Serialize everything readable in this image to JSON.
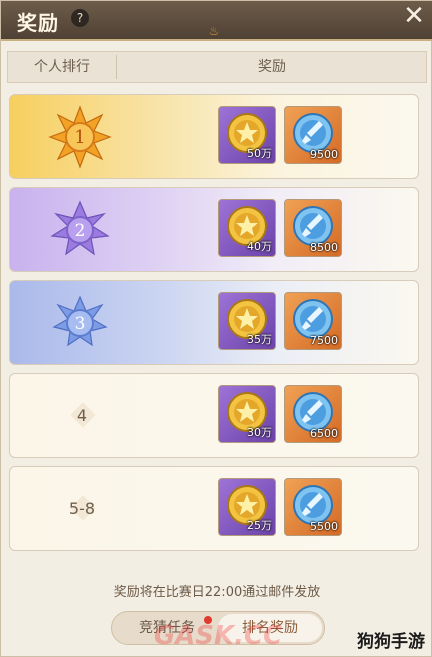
{
  "dialog": {
    "title": "奖励",
    "help_label": "?",
    "close_label": "✕",
    "ornament": "♨"
  },
  "header": {
    "rank_col": "个人排行",
    "reward_col": "奖励"
  },
  "rows": [
    {
      "rank": "1",
      "style": "gold",
      "rewards": [
        {
          "icon": "gold-coin-icon",
          "frame": "purple",
          "qty": "50万"
        },
        {
          "icon": "blue-sword-token-icon",
          "frame": "orange",
          "qty": "9500"
        }
      ]
    },
    {
      "rank": "2",
      "style": "purple",
      "rewards": [
        {
          "icon": "gold-coin-icon",
          "frame": "purple",
          "qty": "40万"
        },
        {
          "icon": "blue-sword-token-icon",
          "frame": "orange",
          "qty": "8500"
        }
      ]
    },
    {
      "rank": "3",
      "style": "blue",
      "rewards": [
        {
          "icon": "gold-coin-icon",
          "frame": "purple",
          "qty": "35万"
        },
        {
          "icon": "blue-sword-token-icon",
          "frame": "orange",
          "qty": "7500"
        }
      ]
    },
    {
      "rank": "4",
      "style": "plain",
      "rewards": [
        {
          "icon": "gold-coin-icon",
          "frame": "purple",
          "qty": "30万"
        },
        {
          "icon": "blue-sword-token-icon",
          "frame": "orange",
          "qty": "6500"
        }
      ]
    },
    {
      "rank": "5-8",
      "style": "plain",
      "rewards": [
        {
          "icon": "gold-coin-icon",
          "frame": "purple",
          "qty": "25万"
        },
        {
          "icon": "blue-sword-token-icon",
          "frame": "orange",
          "qty": "5500"
        }
      ]
    }
  ],
  "footer": {
    "note": "奖励将在比赛日22:00通过邮件发放",
    "tabs": [
      {
        "label": "竞猜任务",
        "selected": false,
        "badge": true
      },
      {
        "label": "排名奖励",
        "selected": true,
        "badge": false
      }
    ]
  },
  "watermark": "GASK.CC",
  "brand": "狗狗手游",
  "colors": {
    "gold_badge": "#f0a030",
    "silver_purple_badge": "#9b7be0",
    "blue_badge": "#6d8fe0",
    "accent_red": "#e03b2f"
  }
}
